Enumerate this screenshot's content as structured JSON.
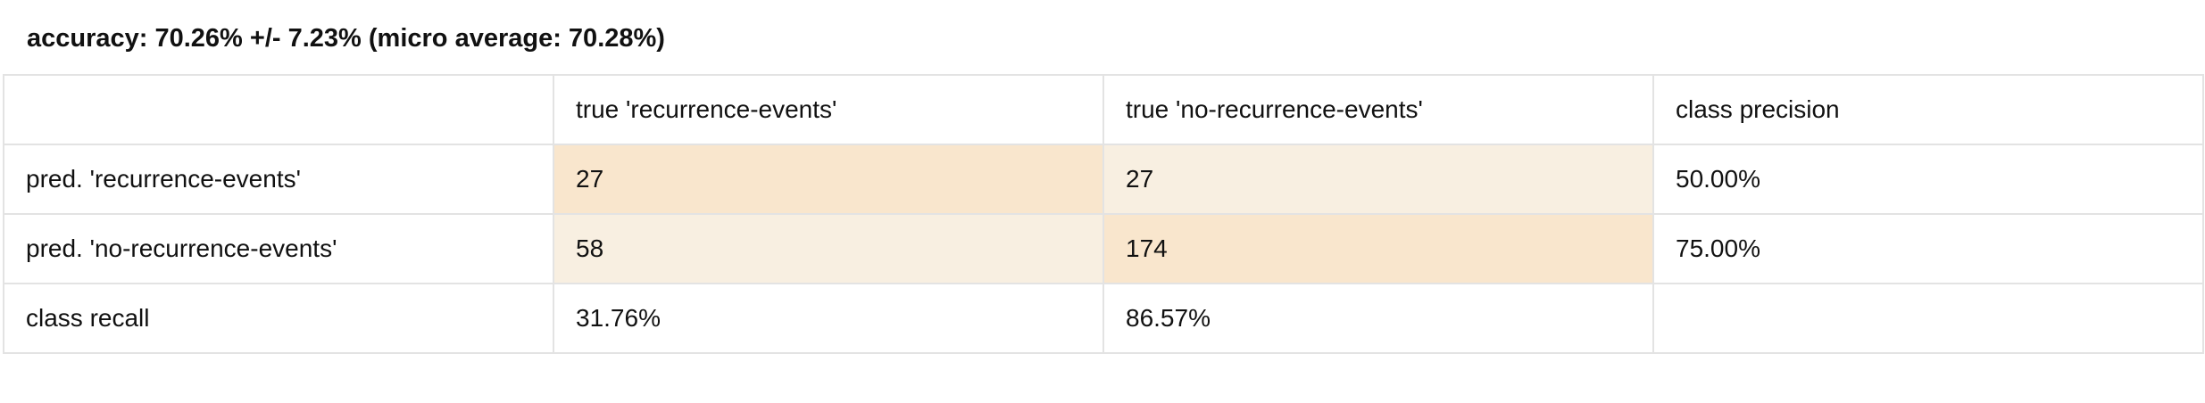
{
  "accuracy_text": "accuracy: 70.26% +/- 7.23% (micro average: 70.28%)",
  "header": {
    "corner": "",
    "col_true_recurrence": "true 'recurrence-events'",
    "col_true_no_recurrence": "true 'no-recurrence-events'",
    "col_class_precision": "class precision"
  },
  "rows": [
    {
      "label": "pred. 'recurrence-events'",
      "true_recurrence": "27",
      "true_no_recurrence": "27",
      "class_precision": "50.00%"
    },
    {
      "label": "pred. 'no-recurrence-events'",
      "true_recurrence": "58",
      "true_no_recurrence": "174",
      "class_precision": "75.00%"
    }
  ],
  "recall_row": {
    "label": "class recall",
    "true_recurrence": "31.76%",
    "true_no_recurrence": "86.57%",
    "blank": ""
  },
  "colors": {
    "cell_highlight_strong": "#f9e6cd",
    "cell_highlight_light": "#f8efe1",
    "grid_border": "#e3e3e3",
    "text": "#111111"
  }
}
